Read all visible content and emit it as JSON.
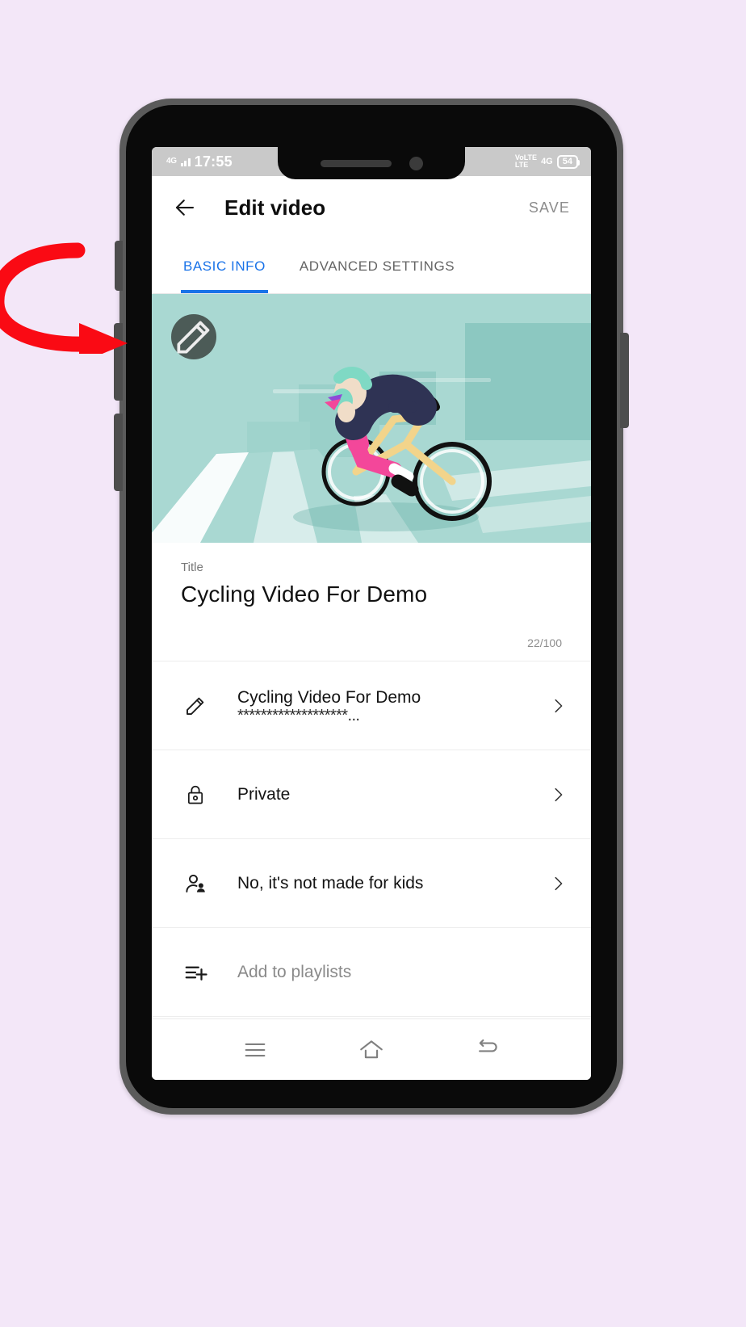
{
  "background_color": "#f3e7f8",
  "accent_color": "#1a73e8",
  "status_bar": {
    "network_label": "4G",
    "time": "17:55",
    "volte_line1": "VoLTE",
    "volte_line2": "LTE",
    "network_right": "4G",
    "battery": "54"
  },
  "app_bar": {
    "back_icon": "back-arrow-icon",
    "title": "Edit video",
    "save_label": "SAVE"
  },
  "tabs": [
    {
      "label": "BASIC INFO",
      "active": true
    },
    {
      "label": "ADVANCED SETTINGS",
      "active": false
    }
  ],
  "thumbnail": {
    "edit_icon": "pencil-icon",
    "alt": "Illustration of a cyclist riding a bicycle on a road",
    "bg_color": "#a9d8d2",
    "badge_color": "#4c5b57"
  },
  "title_field": {
    "label": "Title",
    "value": "Cycling Video For Demo",
    "counter": "22/100"
  },
  "rows": [
    {
      "icon": "pencil-icon",
      "title": "Cycling Video For Demo",
      "subtitle": "*******************...",
      "chevron": true,
      "muted": false
    },
    {
      "icon": "lock-icon",
      "title": "Private",
      "subtitle": "",
      "chevron": true,
      "muted": false
    },
    {
      "icon": "person-add-icon",
      "title": "No, it's not made for kids",
      "subtitle": "",
      "chevron": true,
      "muted": false
    },
    {
      "icon": "playlist-add-icon",
      "title": "Add to playlists",
      "subtitle": "",
      "chevron": false,
      "muted": true
    }
  ],
  "nav_bar": [
    {
      "icon": "recents-menu-icon"
    },
    {
      "icon": "home-icon"
    },
    {
      "icon": "back-nav-icon"
    }
  ],
  "annotation": {
    "type": "curved-red-arrow",
    "color": "#fa0a14",
    "points_to": "thumbnail-edit-badge"
  }
}
